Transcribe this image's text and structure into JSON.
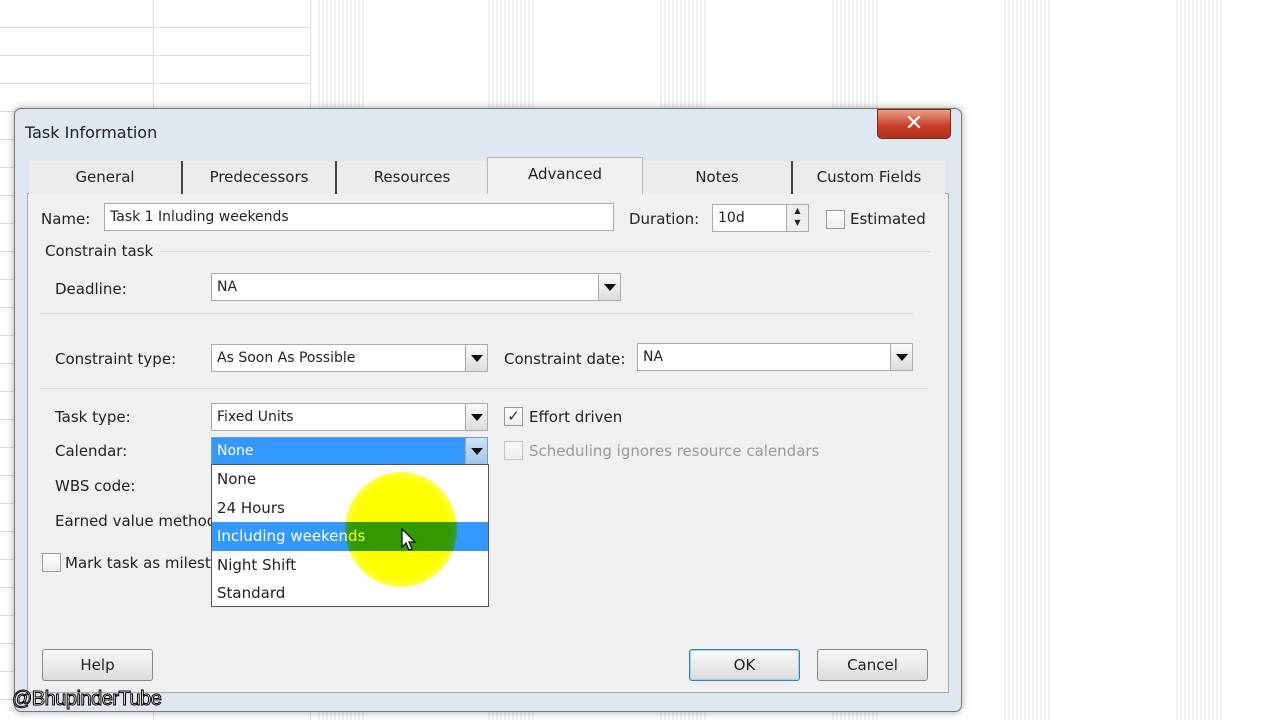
{
  "dialog": {
    "title": "Task Information",
    "close_icon": "close-x-icon"
  },
  "tabs": [
    "General",
    "Predecessors",
    "Resources",
    "Advanced",
    "Notes",
    "Custom Fields"
  ],
  "active_tab": "Advanced",
  "name": {
    "label": "Name:",
    "value": "Task 1 Inluding weekends"
  },
  "duration": {
    "label": "Duration:",
    "value": "10d"
  },
  "estimated": {
    "label": "Estimated",
    "checked": false
  },
  "constrain_group": "Constrain task",
  "deadline": {
    "label": "Deadline:",
    "value": "NA"
  },
  "constraint_type": {
    "label": "Constraint type:",
    "value": "As Soon As Possible"
  },
  "constraint_date": {
    "label": "Constraint date:",
    "value": "NA"
  },
  "task_type": {
    "label": "Task type:",
    "value": "Fixed Units"
  },
  "effort_driven": {
    "label": "Effort driven",
    "checked": true
  },
  "calendar": {
    "label": "Calendar:",
    "value": "None",
    "options": [
      "None",
      "24 Hours",
      "Including weekends",
      "Night Shift",
      "Standard"
    ],
    "highlighted": "Including weekends"
  },
  "scheduling_ignores": {
    "label": "Scheduling ignores resource calendars",
    "checked": false,
    "disabled": true
  },
  "wbs": {
    "label": "WBS code:"
  },
  "earned_value": {
    "label": "Earned value method"
  },
  "milestone": {
    "label": "Mark task as milestone",
    "checked": false
  },
  "buttons": {
    "help": "Help",
    "ok": "OK",
    "cancel": "Cancel"
  },
  "watermark": "@BhupinderTube",
  "colors": {
    "selection": "#3399ff",
    "close": "#c8402a",
    "cursor_highlight": "#ffff00"
  }
}
